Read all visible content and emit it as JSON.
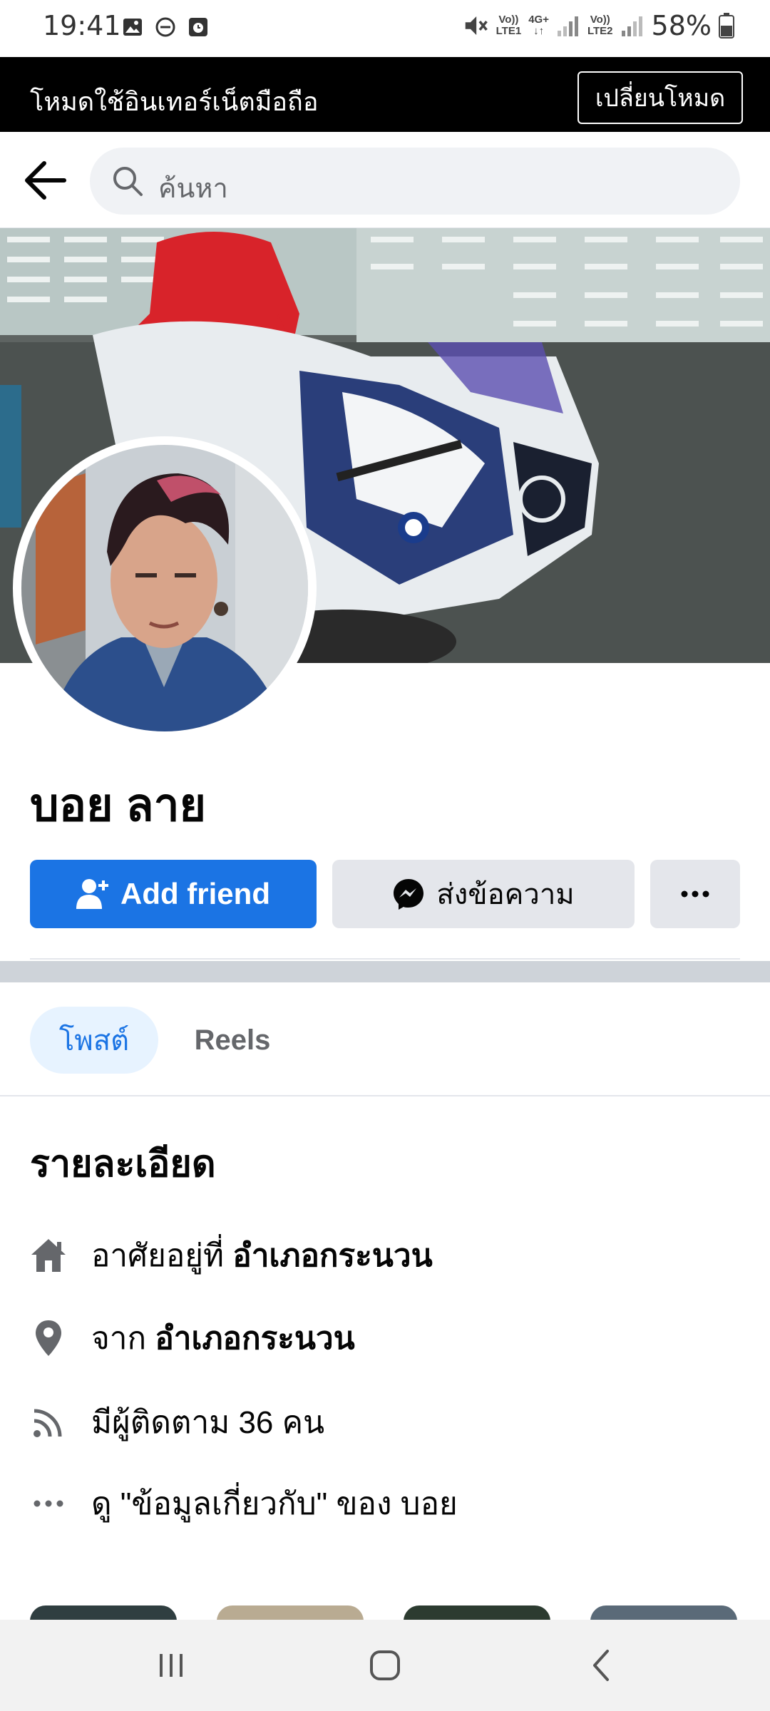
{
  "status_bar": {
    "time": "19:41",
    "battery_percent": "58%",
    "sim1_label_top": "Vo))",
    "sim1_label_bottom": "LTE1",
    "network_label_top": "4G+",
    "network_label_bottom": "↓↑",
    "sim2_label_top": "Vo))",
    "sim2_label_bottom": "LTE2",
    "icons": [
      "gallery-icon",
      "do-not-disturb-icon",
      "alarm-icon",
      "mute-icon",
      "signal-icon",
      "battery-icon"
    ]
  },
  "mode_banner": {
    "text": "โหมดใช้อินเทอร์เน็ตมือถือ",
    "button_label": "เปลี่ยนโหมด"
  },
  "search": {
    "placeholder": "ค้นหา"
  },
  "profile": {
    "name": "บอย ลาย"
  },
  "actions": {
    "add_friend_label": "Add friend",
    "message_label": "ส่งข้อความ"
  },
  "tabs": [
    {
      "label": "โพสต์",
      "active": true
    },
    {
      "label": "Reels",
      "active": false
    }
  ],
  "details": {
    "title": "รายละเอียด",
    "lives_in_prefix": "อาศัยอยู่ที่ ",
    "lives_in_value": "อำเภอกระนวน",
    "from_prefix": "จาก ",
    "from_value": "อำเภอกระนวน",
    "followers": "มีผู้ติดตาม 36 คน",
    "about_link": "ดู \"ข้อมูลเกี่ยวกับ\" ของ บอย"
  },
  "colors": {
    "primary": "#1b74e4",
    "button_gray": "#e4e6eb",
    "tab_active_bg": "#e7f3ff",
    "divider": "#ced3d9"
  }
}
